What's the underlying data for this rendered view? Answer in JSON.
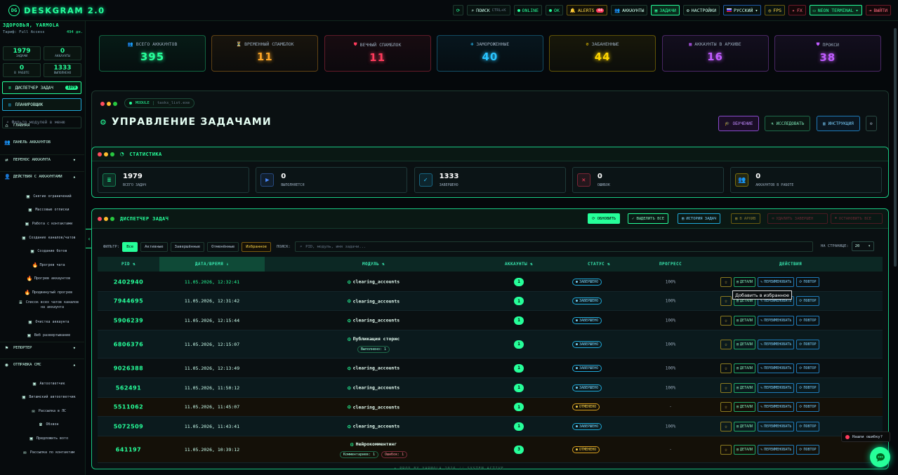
{
  "app": {
    "title": "DESKGRAM 2.0"
  },
  "topbar": {
    "search_label": "ПОИСК",
    "search_shortcut": "CTRL+K",
    "online": "ONLINE",
    "ok": "OK",
    "alerts": "ALERTS",
    "alerts_count": "44",
    "accounts": "АККАУНТЫ",
    "tasks": "ЗАДАЧИ",
    "settings": "НАСТРОЙКИ",
    "language": "РУССКИЙ",
    "fps": "FPS",
    "fx": "FX",
    "theme": "NEON TERMINAL",
    "logout": "ВЫЙТИ"
  },
  "sidebar": {
    "user": "ЗДОРОВЬЯ, YARMOLA",
    "tariff_label": "Тариф: Full Access",
    "tariff_days": "494 дн.",
    "stats": [
      {
        "value": "1979",
        "label": "ЗАДАЧИ"
      },
      {
        "value": "0",
        "label": "АККАУНТЫ"
      },
      {
        "value": "0",
        "label": "В РАБОТЕ"
      },
      {
        "value": "1333",
        "label": "ВЫПОЛНЕНО"
      }
    ],
    "dispatcher": "ДИСПЕТЧЕР ЗАДАЧ",
    "dispatcher_count": "1979",
    "scheduler": "ПЛАНИРОВЩИК",
    "filter_placeholder": "Фильтр модулей в меню",
    "nav": [
      {
        "label": "ГЛАВНАЯ"
      },
      {
        "label": "ПАНЕЛЬ АККАУНТОВ"
      },
      {
        "label": "ПЕРЕНОС АККАУНТА"
      },
      {
        "label": "ДЕЙСТВИЯ С АККАУНТАМИ"
      },
      {
        "label": "Снятие ограничений"
      },
      {
        "label": "Массовые отписки"
      },
      {
        "label": "Работа с контактами"
      },
      {
        "label": "Создание каналов/чатов"
      },
      {
        "label": "Создание ботов"
      },
      {
        "label": "Прогрев чата"
      },
      {
        "label": "Прогрев аккаунтов"
      },
      {
        "label": "Продвинутый прогрев"
      },
      {
        "label": "Список всех чатов каналов"
      },
      {
        "label": "на аккаунта"
      },
      {
        "label": "Очистка аккаунта"
      },
      {
        "label": "Веб развертывание"
      },
      {
        "label": "РЕПОРТЕР"
      },
      {
        "label": "ОТПРАВКА СМС"
      },
      {
        "label": "Автоответчик"
      },
      {
        "label": "Витамский автоответчик"
      },
      {
        "label": "Рассылка в ЛС"
      },
      {
        "label": "Обзвон"
      },
      {
        "label": "Предложить вото"
      },
      {
        "label": "Рассылка по контактам"
      }
    ]
  },
  "kpis": [
    {
      "label": "ВСЕГО АККАУНТОВ",
      "value": "395",
      "color": "#26ff9a"
    },
    {
      "label": "ВРЕМЕННЫЙ СПАМБЛОК",
      "value": "11",
      "color": "#ffa726"
    },
    {
      "label": "ВЕЧНЫЙ СПАМБЛОК",
      "value": "11",
      "color": "#ff3b5c"
    },
    {
      "label": "ЗАМОРОЖЕННЫЕ",
      "value": "40",
      "color": "#29c4ff"
    },
    {
      "label": "ЗАБАНЕННЫЕ",
      "value": "44",
      "color": "#ffd600"
    },
    {
      "label": "АККАУНТЫ В АРХИВЕ",
      "value": "16",
      "color": "#c05cff"
    },
    {
      "label": "ПРОКСИ",
      "value": "38",
      "color": "#c05cff"
    }
  ],
  "module": {
    "badge": "MODULE",
    "file": "tasks_list.exe",
    "title": "УПРАВЛЕНИЕ ЗАДАЧАМИ",
    "btn_learn": "ОБУЧЕНИЕ",
    "btn_research": "ИССЛЕДОВАТЬ",
    "btn_instr": "ИНСТРУКЦИЯ"
  },
  "stats": {
    "title": "СТАТИСТИКА",
    "cards": [
      {
        "value": "1979",
        "label": "ВСЕГО ЗАДАЧ"
      },
      {
        "value": "0",
        "label": "ВЫПОЛНЯЕТСЯ"
      },
      {
        "value": "1333",
        "label": "ЗАВЕРШЕНО"
      },
      {
        "value": "0",
        "label": "ОШИБОК"
      },
      {
        "value": "0",
        "label": "АККАУНТОВ В РАБОТЕ"
      }
    ]
  },
  "dispatcher": {
    "title": "ДИСПЕТЧЕР ЗАДАЧ",
    "btn_refresh": "ОБНОВИТЬ",
    "btn_select_all": "ВЫДЕЛИТЬ ВСЕ",
    "btn_history": "ИСТОРИЯ ЗАДАЧ",
    "btn_archive": "В АРХИВ",
    "btn_delete": "УДАЛИТЬ ЗАВЕРШЕН",
    "btn_stop": "ОСТАНОВИТЬ ВСЕ",
    "filter_label": "ФИЛЬТР:",
    "filters": [
      "Все",
      "Активные",
      "Завершённые",
      "Отменённые",
      "Избранное"
    ],
    "search_label": "ПОИСК:",
    "search_placeholder": "PID, модуль, имя задачи...",
    "per_page_label": "НА СТРАНИЦЕ:",
    "per_page": "20",
    "headers": {
      "pid": "PID",
      "date": "ДАТА/ВРЕМЯ",
      "module": "МОДУЛЬ",
      "accounts": "АККАУНТЫ",
      "status": "СТАТУС",
      "progress": "ПРОГРЕСС",
      "actions": "ДЕЙСТВИЯ"
    },
    "actions": {
      "details": "ДЕТАЛИ",
      "rename": "ПЕРЕИМЕНОВАТЬ",
      "repeat": "ПОВТОР"
    },
    "tooltip": "Добавить в избранное",
    "rows": [
      {
        "pid": "2402940",
        "date": "11.05.2026, 12:32:41",
        "module": "clearing_accounts",
        "accounts": "1",
        "status": "ЗАВЕРШЕНО",
        "progress": "100%"
      },
      {
        "pid": "7944695",
        "date": "11.05.2026, 12:31:42",
        "module": "clearing_accounts",
        "accounts": "1",
        "status": "ЗАВЕРШЕНО",
        "progress": "100%"
      },
      {
        "pid": "5906239",
        "date": "11.05.2026, 12:15:44",
        "module": "clearing_accounts",
        "accounts": "1",
        "status": "ЗАВЕРШЕНО",
        "progress": "100%"
      },
      {
        "pid": "6806376",
        "date": "11.05.2026, 12:15:07",
        "module": "Публикация сторис",
        "sub": [
          "Выполнено: 1"
        ],
        "accounts": "1",
        "status": "ЗАВЕРШЕНО",
        "progress": "100%"
      },
      {
        "pid": "9026388",
        "date": "11.05.2026, 12:13:49",
        "module": "clearing_accounts",
        "accounts": "1",
        "status": "ЗАВЕРШЕНО",
        "progress": "100%"
      },
      {
        "pid": "562491",
        "date": "11.05.2026, 11:50:12",
        "module": "clearing_accounts",
        "accounts": "1",
        "status": "ЗАВЕРШЕНО",
        "progress": "100%"
      },
      {
        "pid": "5511062",
        "date": "11.05.2026, 11:45:07",
        "module": "clearing_accounts",
        "accounts": "1",
        "status": "ОТМЕНЕНО",
        "progress": "-"
      },
      {
        "pid": "5072509",
        "date": "11.05.2026, 11:43:41",
        "module": "clearing_accounts",
        "accounts": "1",
        "status": "ЗАВЕРШЕНО",
        "progress": "100%"
      },
      {
        "pid": "641197",
        "date": "11.05.2026, 10:39:12",
        "module": "Нейрокомментинг",
        "sub": [
          "Комментариев: 1",
          "Ошибок: 1"
        ],
        "accounts": "3",
        "status": "ОТМЕНЕНО",
        "progress": "-"
      }
    ]
  },
  "footer": {
    "left": "PROD BY YARMOLA 2026",
    "right": "SYSTEM ACTIVE"
  },
  "bug": "Нашли ошибку?"
}
